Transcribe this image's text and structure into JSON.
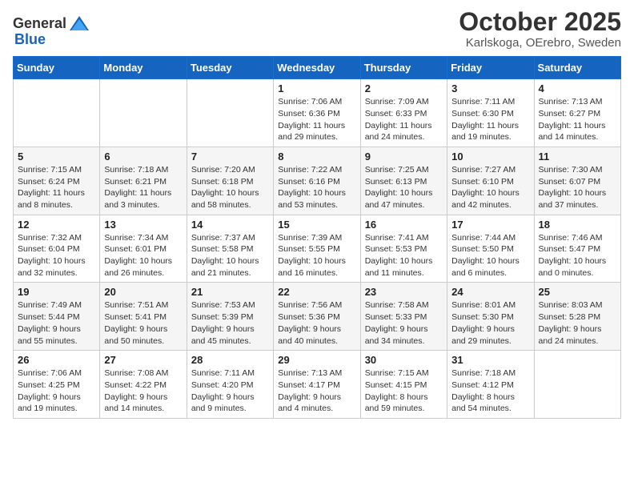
{
  "header": {
    "logo_general": "General",
    "logo_blue": "Blue",
    "title": "October 2025",
    "subtitle": "Karlskoga, OErebro, Sweden"
  },
  "weekdays": [
    "Sunday",
    "Monday",
    "Tuesday",
    "Wednesday",
    "Thursday",
    "Friday",
    "Saturday"
  ],
  "weeks": [
    [
      {
        "day": "",
        "info": ""
      },
      {
        "day": "",
        "info": ""
      },
      {
        "day": "",
        "info": ""
      },
      {
        "day": "1",
        "info": "Sunrise: 7:06 AM\nSunset: 6:36 PM\nDaylight: 11 hours and 29 minutes."
      },
      {
        "day": "2",
        "info": "Sunrise: 7:09 AM\nSunset: 6:33 PM\nDaylight: 11 hours and 24 minutes."
      },
      {
        "day": "3",
        "info": "Sunrise: 7:11 AM\nSunset: 6:30 PM\nDaylight: 11 hours and 19 minutes."
      },
      {
        "day": "4",
        "info": "Sunrise: 7:13 AM\nSunset: 6:27 PM\nDaylight: 11 hours and 14 minutes."
      }
    ],
    [
      {
        "day": "5",
        "info": "Sunrise: 7:15 AM\nSunset: 6:24 PM\nDaylight: 11 hours and 8 minutes."
      },
      {
        "day": "6",
        "info": "Sunrise: 7:18 AM\nSunset: 6:21 PM\nDaylight: 11 hours and 3 minutes."
      },
      {
        "day": "7",
        "info": "Sunrise: 7:20 AM\nSunset: 6:18 PM\nDaylight: 10 hours and 58 minutes."
      },
      {
        "day": "8",
        "info": "Sunrise: 7:22 AM\nSunset: 6:16 PM\nDaylight: 10 hours and 53 minutes."
      },
      {
        "day": "9",
        "info": "Sunrise: 7:25 AM\nSunset: 6:13 PM\nDaylight: 10 hours and 47 minutes."
      },
      {
        "day": "10",
        "info": "Sunrise: 7:27 AM\nSunset: 6:10 PM\nDaylight: 10 hours and 42 minutes."
      },
      {
        "day": "11",
        "info": "Sunrise: 7:30 AM\nSunset: 6:07 PM\nDaylight: 10 hours and 37 minutes."
      }
    ],
    [
      {
        "day": "12",
        "info": "Sunrise: 7:32 AM\nSunset: 6:04 PM\nDaylight: 10 hours and 32 minutes."
      },
      {
        "day": "13",
        "info": "Sunrise: 7:34 AM\nSunset: 6:01 PM\nDaylight: 10 hours and 26 minutes."
      },
      {
        "day": "14",
        "info": "Sunrise: 7:37 AM\nSunset: 5:58 PM\nDaylight: 10 hours and 21 minutes."
      },
      {
        "day": "15",
        "info": "Sunrise: 7:39 AM\nSunset: 5:55 PM\nDaylight: 10 hours and 16 minutes."
      },
      {
        "day": "16",
        "info": "Sunrise: 7:41 AM\nSunset: 5:53 PM\nDaylight: 10 hours and 11 minutes."
      },
      {
        "day": "17",
        "info": "Sunrise: 7:44 AM\nSunset: 5:50 PM\nDaylight: 10 hours and 6 minutes."
      },
      {
        "day": "18",
        "info": "Sunrise: 7:46 AM\nSunset: 5:47 PM\nDaylight: 10 hours and 0 minutes."
      }
    ],
    [
      {
        "day": "19",
        "info": "Sunrise: 7:49 AM\nSunset: 5:44 PM\nDaylight: 9 hours and 55 minutes."
      },
      {
        "day": "20",
        "info": "Sunrise: 7:51 AM\nSunset: 5:41 PM\nDaylight: 9 hours and 50 minutes."
      },
      {
        "day": "21",
        "info": "Sunrise: 7:53 AM\nSunset: 5:39 PM\nDaylight: 9 hours and 45 minutes."
      },
      {
        "day": "22",
        "info": "Sunrise: 7:56 AM\nSunset: 5:36 PM\nDaylight: 9 hours and 40 minutes."
      },
      {
        "day": "23",
        "info": "Sunrise: 7:58 AM\nSunset: 5:33 PM\nDaylight: 9 hours and 34 minutes."
      },
      {
        "day": "24",
        "info": "Sunrise: 8:01 AM\nSunset: 5:30 PM\nDaylight: 9 hours and 29 minutes."
      },
      {
        "day": "25",
        "info": "Sunrise: 8:03 AM\nSunset: 5:28 PM\nDaylight: 9 hours and 24 minutes."
      }
    ],
    [
      {
        "day": "26",
        "info": "Sunrise: 7:06 AM\nSunset: 4:25 PM\nDaylight: 9 hours and 19 minutes."
      },
      {
        "day": "27",
        "info": "Sunrise: 7:08 AM\nSunset: 4:22 PM\nDaylight: 9 hours and 14 minutes."
      },
      {
        "day": "28",
        "info": "Sunrise: 7:11 AM\nSunset: 4:20 PM\nDaylight: 9 hours and 9 minutes."
      },
      {
        "day": "29",
        "info": "Sunrise: 7:13 AM\nSunset: 4:17 PM\nDaylight: 9 hours and 4 minutes."
      },
      {
        "day": "30",
        "info": "Sunrise: 7:15 AM\nSunset: 4:15 PM\nDaylight: 8 hours and 59 minutes."
      },
      {
        "day": "31",
        "info": "Sunrise: 7:18 AM\nSunset: 4:12 PM\nDaylight: 8 hours and 54 minutes."
      },
      {
        "day": "",
        "info": ""
      }
    ]
  ]
}
